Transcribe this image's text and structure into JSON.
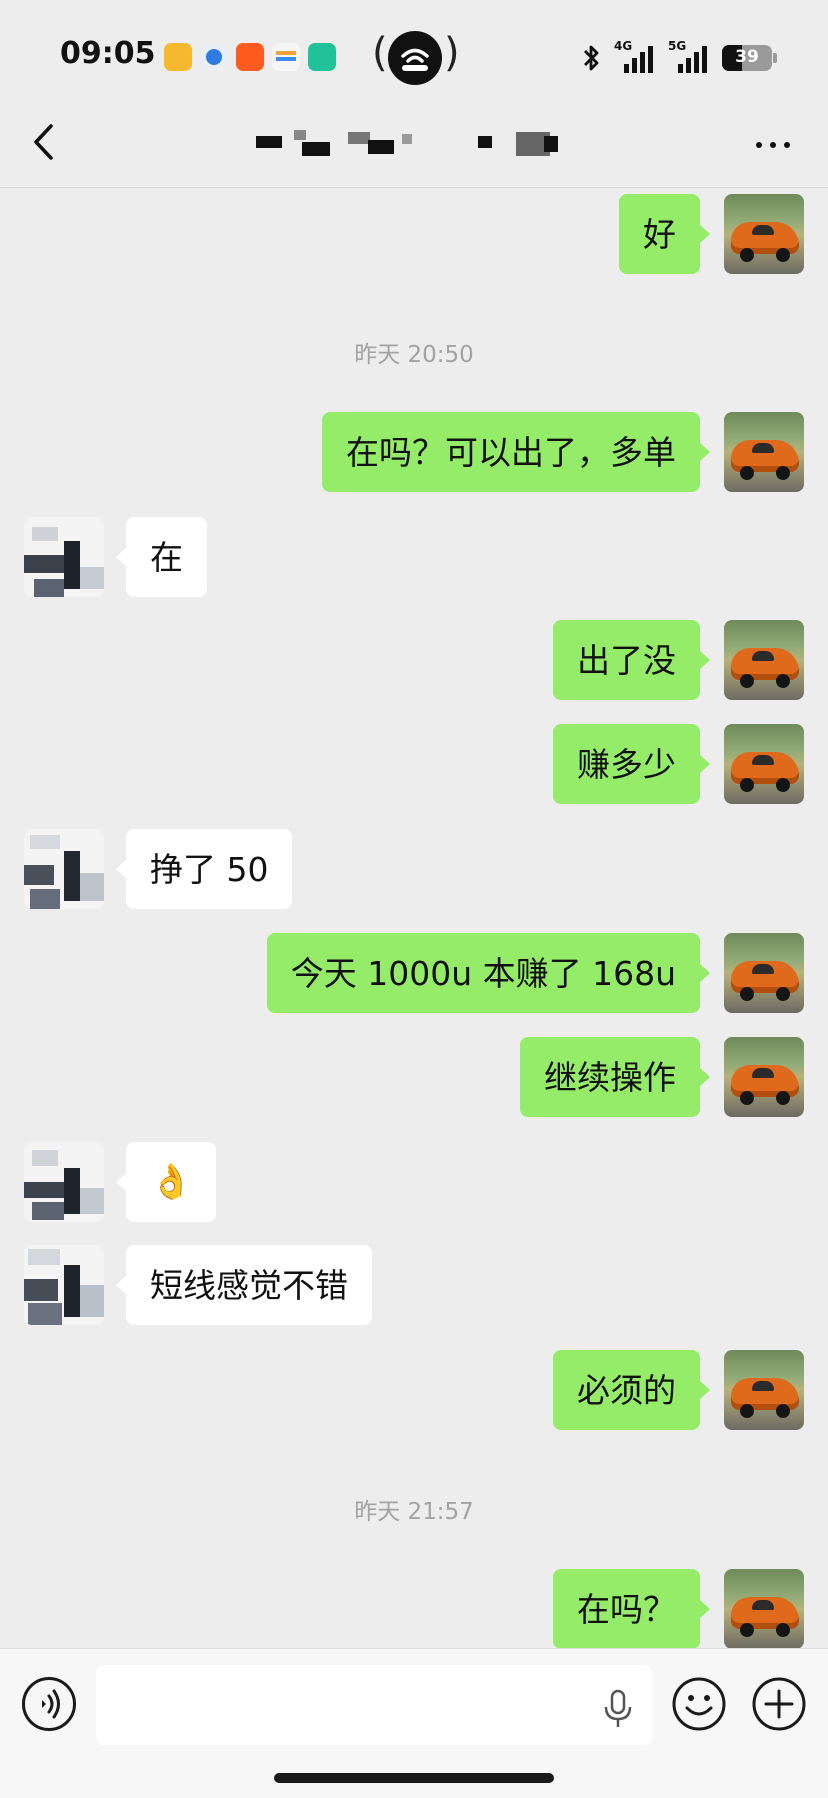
{
  "status_bar": {
    "time": "09:05",
    "network_1": "4G",
    "network_2": "5G",
    "battery": "39"
  },
  "nav": {
    "icons": {
      "back": "chevron-left-icon",
      "more": "more-icon"
    }
  },
  "messages": [
    {
      "side": "self",
      "text": "好"
    },
    {
      "side": "time",
      "text": "昨天 20:50"
    },
    {
      "side": "self",
      "text": "在吗？可以出了，多单"
    },
    {
      "side": "other",
      "text": "在"
    },
    {
      "side": "self",
      "text": "出了没"
    },
    {
      "side": "self",
      "text": "赚多少"
    },
    {
      "side": "other",
      "text": "挣了 50"
    },
    {
      "side": "self",
      "text": "今天 1000u 本赚了 168u"
    },
    {
      "side": "self",
      "text": "继续操作"
    },
    {
      "side": "other",
      "text": "👌"
    },
    {
      "side": "other",
      "text": "短线感觉不错"
    },
    {
      "side": "self",
      "text": "必须的"
    },
    {
      "side": "time",
      "text": "昨天 21:57"
    },
    {
      "side": "self",
      "text": "在吗？"
    }
  ],
  "input_bar": {
    "input_value": "",
    "icons": {
      "voice": "voice-icon",
      "mic": "microphone-icon",
      "emoji": "emoji-icon",
      "add": "plus-circle-icon"
    }
  },
  "colors": {
    "background": "#ededed",
    "self_bubble": "#95ec69",
    "other_bubble": "#ffffff",
    "timestamp": "#a3a3a3"
  }
}
